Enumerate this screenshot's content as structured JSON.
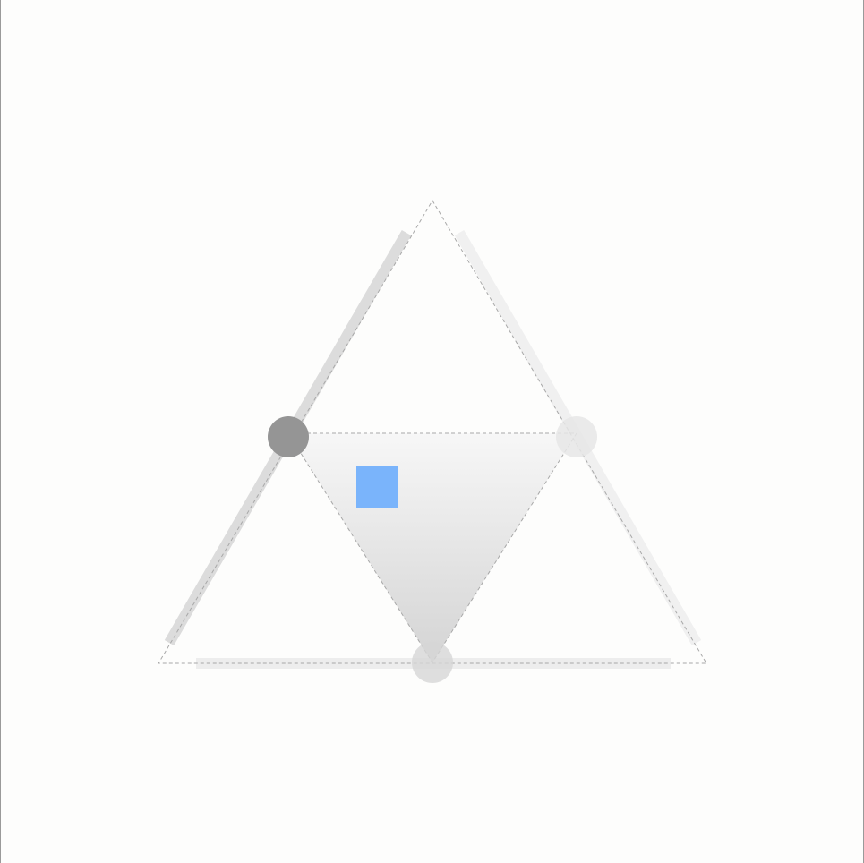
{
  "diagram": {
    "colors": {
      "background": "#fdfdfc",
      "outline_dash": "#a8a8a8",
      "side_left": "#dcdcdc",
      "side_right": "#f0f0f0",
      "side_bottom": "#ededed",
      "node_left": "#959595",
      "node_right": "#e6e6e6",
      "node_bottom": "#d6d6d6",
      "inner_gradient_top": "#f7f7f7",
      "inner_gradient_bottom": "#d4d4d4",
      "marker": "#7ab4fb"
    },
    "nodes": [
      {
        "id": "left",
        "shade": "dark"
      },
      {
        "id": "right",
        "shade": "light"
      },
      {
        "id": "bottom",
        "shade": "medium"
      }
    ],
    "marker_shape": "square"
  }
}
